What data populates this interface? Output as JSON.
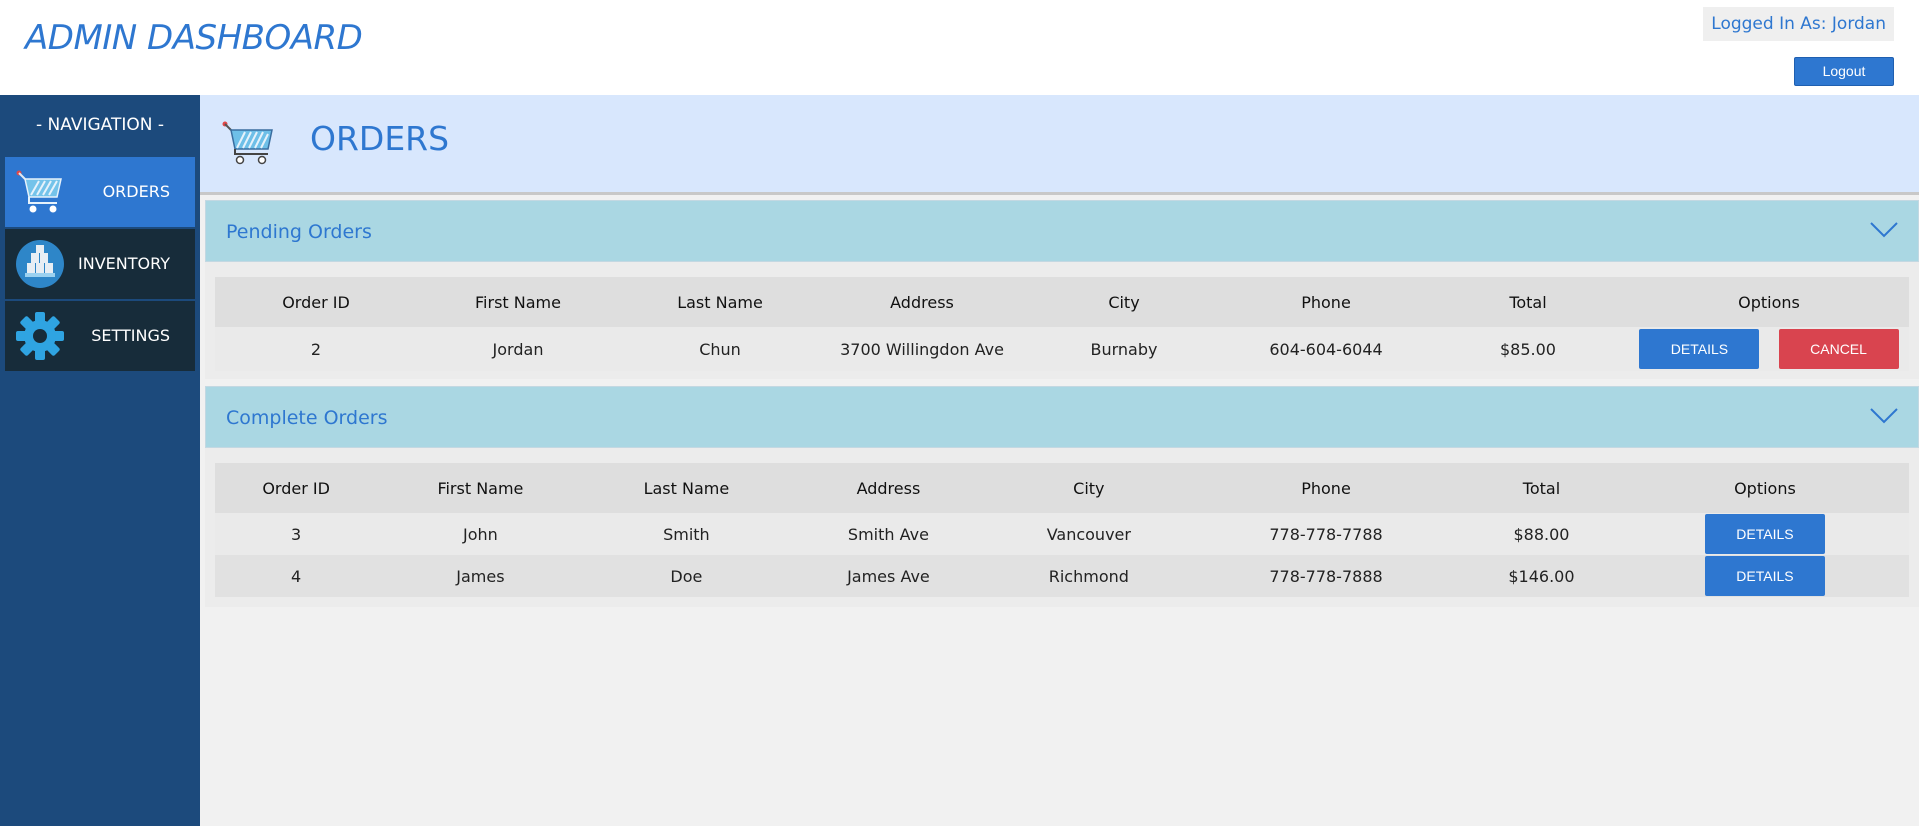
{
  "header": {
    "brand": "ADMIN DASHBOARD",
    "logged_in": "Logged In As: Jordan",
    "logout_label": "Logout"
  },
  "sidebar": {
    "title": "- NAVIGATION -",
    "items": [
      {
        "label": "ORDERS",
        "icon": "cart-icon",
        "active": true
      },
      {
        "label": "INVENTORY",
        "icon": "boxes-icon",
        "active": false
      },
      {
        "label": "SETTINGS",
        "icon": "gear-icon",
        "active": false
      }
    ]
  },
  "page": {
    "title": "ORDERS",
    "icon": "cart-icon"
  },
  "pending": {
    "title": "Pending Orders",
    "columns": [
      "Order ID",
      "First Name",
      "Last Name",
      "Address",
      "City",
      "Phone",
      "Total",
      "Options"
    ],
    "rows": [
      {
        "id": "2",
        "first": "Jordan",
        "last": "Chun",
        "address": "3700 Willingdon Ave",
        "city": "Burnaby",
        "phone": "604-604-6044",
        "total": "$85.00"
      }
    ],
    "details_label": "DETAILS",
    "cancel_label": "CANCEL"
  },
  "complete": {
    "title": "Complete Orders",
    "columns": [
      "Order ID",
      "First Name",
      "Last Name",
      "Address",
      "City",
      "Phone",
      "Total",
      "Options"
    ],
    "rows": [
      {
        "id": "3",
        "first": "John",
        "last": "Smith",
        "address": "Smith Ave",
        "city": "Vancouver",
        "phone": "778-778-7788",
        "total": "$88.00"
      },
      {
        "id": "4",
        "first": "James",
        "last": "Doe",
        "address": "James Ave",
        "city": "Richmond",
        "phone": "778-778-7888",
        "total": "$146.00"
      }
    ],
    "details_label": "DETAILS"
  },
  "colors": {
    "accent": "#2e77d0",
    "sidebar": "#1c4a7c",
    "nav_item": "#172c3a",
    "section_header": "#aad7e3",
    "page_header": "#d8e7fd",
    "cancel": "#d9444f"
  }
}
